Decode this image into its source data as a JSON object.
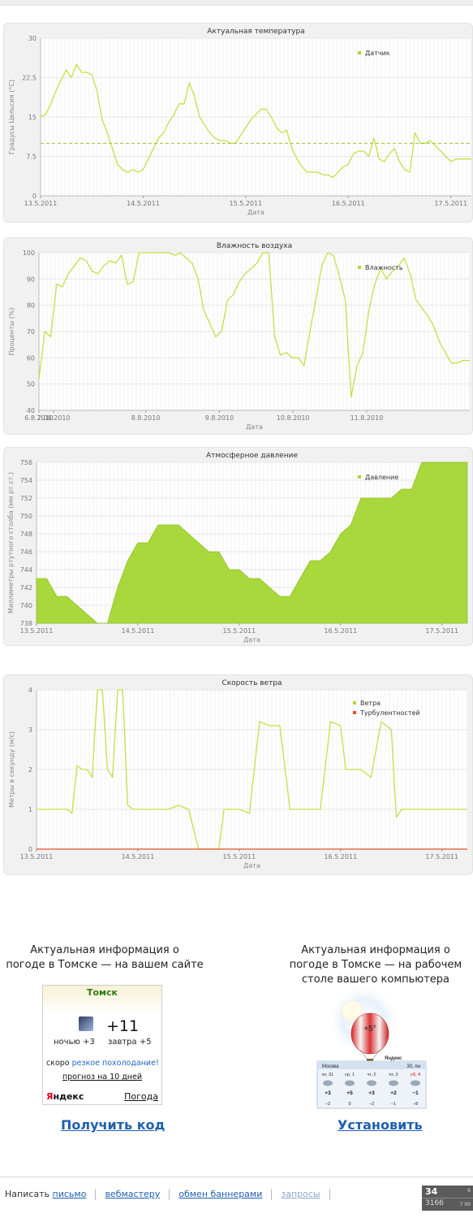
{
  "colors": {
    "series": "#c3e047",
    "fill": "#a8d83b",
    "grid": "#e6e6e6",
    "turbulence": "#e8502a",
    "link": "#1f5fb0"
  },
  "chart_data": [
    {
      "type": "line",
      "title": "Актуальная температура",
      "xlabel": "Дата",
      "ylabel": "Градусы Цельсия (°C)",
      "ylim": [
        0,
        30
      ],
      "yticks": [
        0,
        7.5,
        15,
        22.5,
        30
      ],
      "ytick_labels": [
        "0",
        "7.5",
        "15",
        "22.5",
        "30"
      ],
      "xlim": [
        0,
        4.2
      ],
      "xticks": [
        0,
        1,
        2,
        3,
        4
      ],
      "xtick_labels": [
        "13.5.2011",
        "14.5.2011",
        "15.5.2011",
        "16.5.2011",
        "17.5.2011"
      ],
      "legend": [
        "Датчик"
      ],
      "legend_position": "top-right",
      "reference_line": 10,
      "series": [
        {
          "name": "Датчик",
          "x": [
            0,
            0.05,
            0.1,
            0.15,
            0.2,
            0.25,
            0.3,
            0.35,
            0.4,
            0.45,
            0.5,
            0.55,
            0.6,
            0.65,
            0.7,
            0.75,
            0.8,
            0.85,
            0.9,
            0.95,
            1.0,
            1.05,
            1.1,
            1.15,
            1.2,
            1.25,
            1.3,
            1.35,
            1.4,
            1.45,
            1.5,
            1.55,
            1.6,
            1.65,
            1.7,
            1.75,
            1.8,
            1.85,
            1.9,
            1.95,
            2.0,
            2.05,
            2.1,
            2.15,
            2.2,
            2.25,
            2.3,
            2.35,
            2.4,
            2.45,
            2.5,
            2.55,
            2.6,
            2.65,
            2.7,
            2.75,
            2.8,
            2.85,
            2.9,
            2.95,
            3.0,
            3.05,
            3.1,
            3.15,
            3.2,
            3.25,
            3.3,
            3.35,
            3.4,
            3.45,
            3.5,
            3.55,
            3.6,
            3.65,
            3.7,
            3.75,
            3.8,
            3.85,
            3.9,
            3.95,
            4.0,
            4.05,
            4.1,
            4.15,
            4.2
          ],
          "values": [
            15,
            15.5,
            17.5,
            20,
            22,
            24,
            22.5,
            25,
            23.5,
            23.5,
            23,
            20,
            14.5,
            12,
            9,
            6,
            5,
            4.5,
            5,
            4.5,
            5,
            7,
            9,
            11,
            12,
            14,
            15.5,
            17.5,
            17.5,
            21.5,
            19,
            15,
            13.5,
            12,
            11,
            10.5,
            10.5,
            10,
            10,
            11.5,
            13,
            14.5,
            15.5,
            16.5,
            16.5,
            15,
            13,
            12,
            12.5,
            9,
            7,
            5.5,
            4.5,
            4.5,
            4.5,
            4,
            4,
            3.5,
            4.5,
            5.5,
            6,
            8,
            8.5,
            8.5,
            7.5,
            11,
            7,
            6.5,
            8,
            9,
            6.5,
            5,
            4.5,
            12,
            10,
            10,
            10.5,
            9.5,
            8.5,
            7.5,
            6.5,
            7,
            7,
            7,
            7
          ]
        }
      ]
    },
    {
      "type": "line",
      "title": "Влажность воздуха",
      "xlabel": "Дата",
      "ylabel": "Проценты (%)",
      "ylim": [
        40,
        100
      ],
      "yticks": [
        40,
        50,
        60,
        70,
        80,
        90,
        100
      ],
      "ytick_labels": [
        "40",
        "50",
        "60",
        "70",
        "80",
        "90",
        "100"
      ],
      "xlim": [
        0,
        5.85
      ],
      "xticks": [
        0,
        0.2,
        1.45,
        2.45,
        3.45,
        4.45
      ],
      "xtick_labels": [
        "6.8.2010",
        "7.08.2010",
        "8.8.2010",
        "9.8.2010",
        "10.8.2010",
        "11.8.2010"
      ],
      "legend": [
        "Влажность"
      ],
      "legend_position": "top-right",
      "series": [
        {
          "name": "Влажность",
          "x": [
            0,
            0.08,
            0.16,
            0.24,
            0.32,
            0.4,
            0.48,
            0.56,
            0.64,
            0.72,
            0.8,
            0.88,
            0.96,
            1.04,
            1.12,
            1.2,
            1.28,
            1.36,
            1.44,
            1.52,
            1.6,
            1.68,
            1.76,
            1.84,
            1.92,
            2.0,
            2.08,
            2.16,
            2.24,
            2.32,
            2.4,
            2.48,
            2.56,
            2.64,
            2.72,
            2.8,
            2.88,
            2.96,
            3.04,
            3.12,
            3.2,
            3.28,
            3.36,
            3.44,
            3.52,
            3.6,
            3.68,
            3.76,
            3.84,
            3.92,
            4.0,
            4.08,
            4.16,
            4.24,
            4.32,
            4.4,
            4.48,
            4.56,
            4.64,
            4.72,
            4.8,
            4.88,
            4.96,
            5.04,
            5.12,
            5.2,
            5.28,
            5.36,
            5.44,
            5.52,
            5.6,
            5.68,
            5.76,
            5.85
          ],
          "values": [
            52,
            70,
            68,
            88,
            87,
            92,
            95,
            98,
            97,
            93,
            92,
            95,
            97,
            96,
            99,
            88,
            89,
            100,
            100,
            100,
            100,
            100,
            100,
            99,
            100,
            98,
            96,
            90,
            78,
            73,
            68,
            70,
            82,
            84,
            89,
            92,
            94,
            96,
            100,
            100,
            68,
            61,
            62,
            60,
            60,
            57,
            70,
            82,
            95,
            100,
            99,
            91,
            82,
            45,
            57,
            62,
            78,
            88,
            94,
            90,
            93,
            95,
            98,
            92,
            82,
            79,
            76,
            72,
            66,
            62,
            58,
            58,
            59,
            59
          ]
        }
      ]
    },
    {
      "type": "area",
      "title": "Атмосферное давление",
      "xlabel": "Дата",
      "ylabel": "Миллиметры ртутного столба (мм рт.ст.)",
      "ylim": [
        738,
        756
      ],
      "yticks": [
        738,
        740,
        742,
        744,
        746,
        748,
        750,
        752,
        754,
        756
      ],
      "ytick_labels": [
        "738",
        "740",
        "742",
        "744",
        "746",
        "748",
        "750",
        "752",
        "754",
        "756"
      ],
      "xlim": [
        0,
        4.25
      ],
      "xticks": [
        0,
        1,
        2,
        3,
        4
      ],
      "xtick_labels": [
        "13.5.2011",
        "14.5.2011",
        "15.5.2011",
        "16.5.2011",
        "17.5.2011"
      ],
      "legend": [
        "Давление"
      ],
      "legend_position": "top-right",
      "series": [
        {
          "name": "Давление",
          "x": [
            0,
            0.1,
            0.2,
            0.3,
            0.4,
            0.5,
            0.6,
            0.7,
            0.8,
            0.9,
            1.0,
            1.1,
            1.2,
            1.3,
            1.4,
            1.5,
            1.6,
            1.7,
            1.8,
            1.9,
            2.0,
            2.1,
            2.2,
            2.3,
            2.4,
            2.5,
            2.6,
            2.7,
            2.8,
            2.9,
            3.0,
            3.1,
            3.2,
            3.3,
            3.4,
            3.5,
            3.6,
            3.7,
            3.8,
            3.9,
            4.0,
            4.1,
            4.2,
            4.25
          ],
          "values": [
            743,
            743,
            741,
            741,
            740,
            739,
            738,
            736,
            742,
            745,
            747,
            747,
            749,
            749,
            749,
            748,
            747,
            746,
            746,
            744,
            744,
            743,
            743,
            742,
            741,
            741,
            743,
            745,
            745,
            746,
            748,
            749,
            752,
            752,
            752,
            752,
            753,
            753,
            756,
            756,
            756,
            756,
            756,
            756
          ]
        }
      ]
    },
    {
      "type": "line",
      "title": "Скорость ветра",
      "xlabel": "Дата",
      "ylabel": "Метры в секунду (м/с)",
      "ylim": [
        0,
        4
      ],
      "yticks": [
        0,
        1,
        2,
        3,
        4
      ],
      "ytick_labels": [
        "0",
        "1",
        "2",
        "3",
        "4"
      ],
      "xlim": [
        0,
        4.25
      ],
      "xticks": [
        0,
        1,
        2,
        3,
        4
      ],
      "xtick_labels": [
        "13.5.2011",
        "14.5.2011",
        "15.5.2011",
        "16.5.2011",
        "17.5.2011"
      ],
      "legend": [
        "Ветра",
        "Турбулентностей"
      ],
      "legend_position": "top-right",
      "series": [
        {
          "name": "Ветра",
          "x": [
            0,
            0.1,
            0.2,
            0.3,
            0.35,
            0.4,
            0.45,
            0.5,
            0.55,
            0.6,
            0.65,
            0.7,
            0.75,
            0.8,
            0.85,
            0.9,
            0.95,
            1.0,
            1.05,
            1.1,
            1.15,
            1.2,
            1.25,
            1.3,
            1.4,
            1.5,
            1.6,
            1.7,
            1.75,
            1.8,
            1.85,
            1.9,
            1.95,
            2.0,
            2.1,
            2.2,
            2.3,
            2.4,
            2.5,
            2.6,
            2.7,
            2.8,
            2.9,
            3.0,
            3.05,
            3.1,
            3.2,
            3.3,
            3.4,
            3.5,
            3.55,
            3.6,
            3.65,
            3.7,
            3.8,
            3.9,
            4.0,
            4.05,
            4.1,
            4.15,
            4.2,
            4.25
          ],
          "values": [
            1,
            1,
            1,
            1,
            0.9,
            2.1,
            2,
            2,
            1.8,
            4,
            4,
            2,
            1.8,
            4,
            4,
            1.1,
            1,
            1,
            1,
            1,
            1,
            1,
            1,
            1,
            1.1,
            1,
            0,
            0,
            0,
            0,
            1,
            1,
            1,
            1,
            0.9,
            3.2,
            3.1,
            3.1,
            1,
            1,
            1,
            1,
            3.2,
            3.1,
            2,
            2,
            2,
            1.8,
            3.2,
            3,
            0.8,
            1,
            1,
            1,
            1,
            1,
            1,
            1,
            1,
            1,
            1,
            1
          ]
        },
        {
          "name": "Турбулентностей",
          "x": [
            0,
            4.25
          ],
          "values": [
            0,
            0
          ]
        }
      ]
    }
  ],
  "widgets": {
    "site": {
      "caption_1": "Актуальная информация о",
      "caption_2": "погоде в Томске — на вашем сайте",
      "city": "Томск",
      "temp": "+11",
      "night": "ночью +3",
      "tomorrow": "завтра  +5",
      "soon": "скоро ",
      "soon_link": "резкое похолодание!",
      "forecast": "прогноз на 10 дней",
      "logo_first": "Я",
      "logo_rest": "ндекс",
      "weather": "Погода",
      "get_code": "Получить код",
      "icon": "night-cloud-icon"
    },
    "desktop": {
      "caption_1": "Актуальная информация о",
      "caption_2": "погоде в Томске — на рабочем",
      "caption_3": "столе вашего компьютера",
      "install": "Установить",
      "balloon_temp": "+5°",
      "city": "Москва",
      "date": "30, пн",
      "days": [
        "вт, 31",
        "ср, 1",
        "чт, 2",
        "пт, 3",
        "сб, 4"
      ],
      "highs": [
        "+3",
        "+5",
        "+3",
        "+2",
        "−1"
      ],
      "lows": [
        "−2",
        "0",
        "−2",
        "−1",
        "−8"
      ],
      "brand": "Яндекс",
      "icon": "balloon-icon"
    }
  },
  "footer": {
    "write": "Написать",
    "letter": "письмо",
    "webmaster": "вебмастеру",
    "banners": "обмен баннерами",
    "requests": "запросы"
  },
  "counter": {
    "top": "34",
    "top_small": "6",
    "bottom": "3166",
    "bottom_small": "7 00"
  }
}
